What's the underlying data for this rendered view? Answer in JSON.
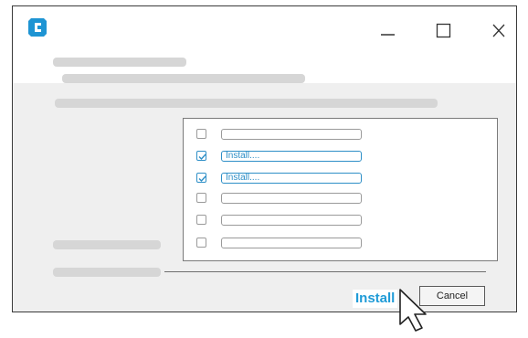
{
  "colors": {
    "accent": "#2e8fc7",
    "install_blue": "#1f9bd7",
    "logo_blue": "#1e94d3",
    "skeleton": "#d6d6d6",
    "body_bg": "#efefef"
  },
  "titlebar": {
    "logo_icon": "app-logo-icon",
    "minimize_icon": "minimize-icon",
    "maximize_icon": "maximize-icon",
    "close_icon": "close-icon"
  },
  "list": {
    "items": [
      {
        "checked": false,
        "text": ""
      },
      {
        "checked": true,
        "text": "Install...."
      },
      {
        "checked": true,
        "text": "Install...."
      },
      {
        "checked": false,
        "text": ""
      },
      {
        "checked": false,
        "text": ""
      },
      {
        "checked": false,
        "text": ""
      }
    ]
  },
  "footer": {
    "install_label": "Install",
    "cancel_label": "Cancel",
    "cursor_icon": "mouse-pointer-icon"
  }
}
